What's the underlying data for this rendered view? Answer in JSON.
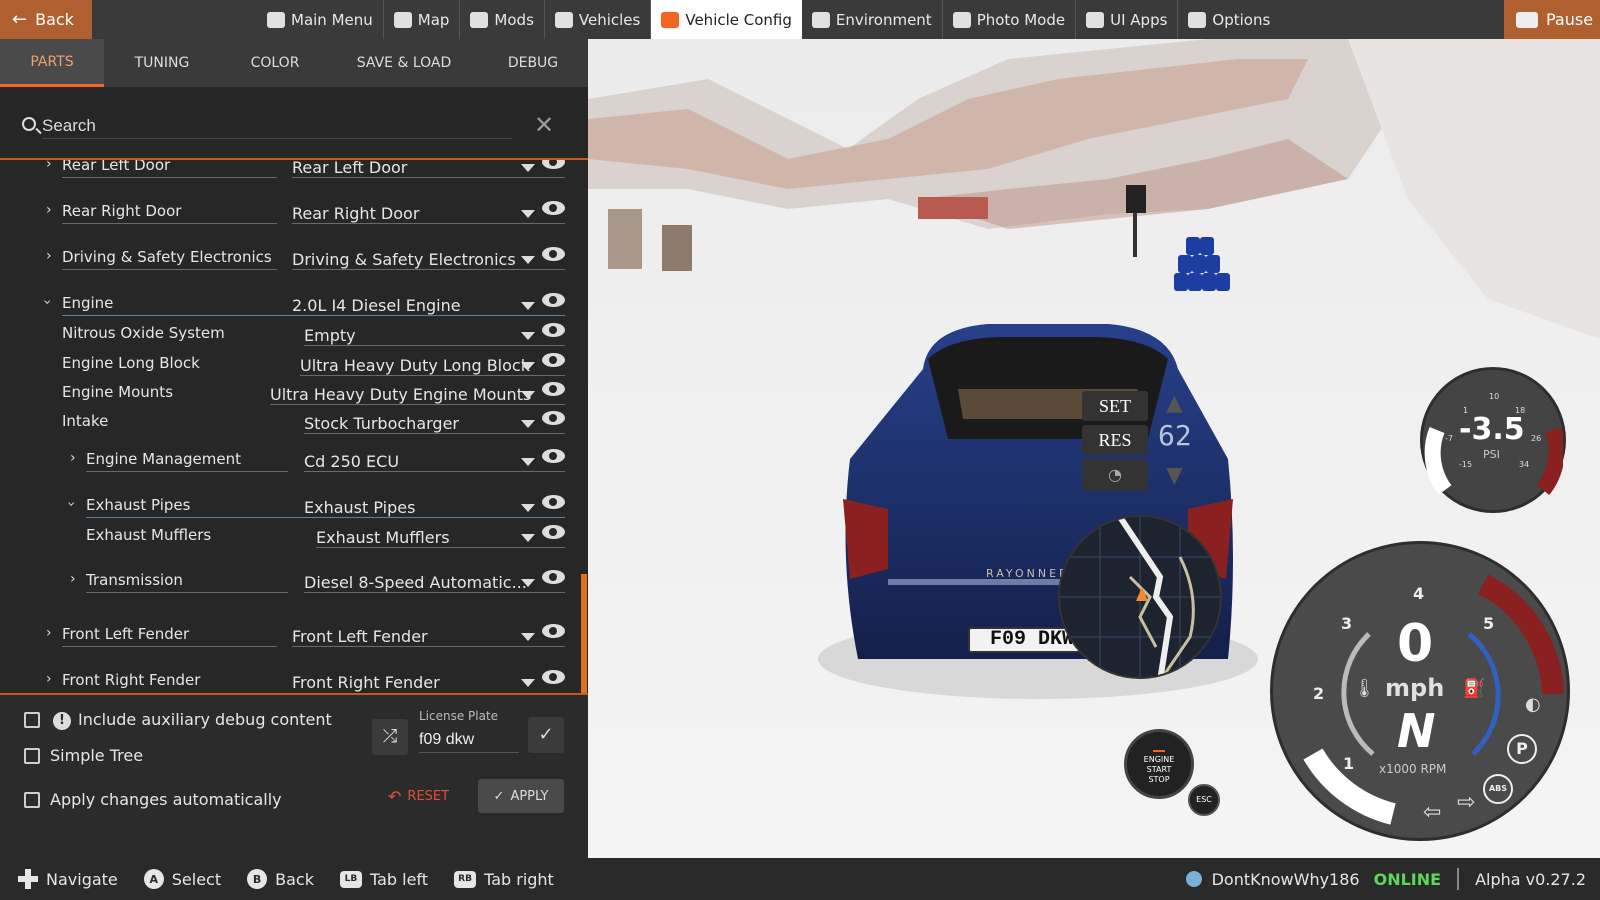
{
  "topbar": {
    "back": "Back",
    "pause": "Pause",
    "nav": [
      {
        "label": "Main Menu",
        "icon": "main-menu-icon",
        "active": false
      },
      {
        "label": "Map",
        "icon": "map-icon",
        "active": false
      },
      {
        "label": "Mods",
        "icon": "puzzle-icon",
        "active": false
      },
      {
        "label": "Vehicles",
        "icon": "car-icon",
        "active": false
      },
      {
        "label": "Vehicle Config",
        "icon": "engine-icon",
        "active": true
      },
      {
        "label": "Environment",
        "icon": "weather-icon",
        "active": false
      },
      {
        "label": "Photo Mode",
        "icon": "camera-icon",
        "active": false
      },
      {
        "label": "UI Apps",
        "icon": "apps-icon",
        "active": false
      },
      {
        "label": "Options",
        "icon": "sliders-icon",
        "active": false
      }
    ]
  },
  "tabs": [
    "PARTS",
    "TUNING",
    "COLOR",
    "SAVE & LOAD",
    "DEBUG"
  ],
  "search": {
    "placeholder": "Search"
  },
  "parts": [
    {
      "label": "Rear Left Door",
      "value": "Rear Left Door",
      "expandable": true,
      "expanded": false
    },
    {
      "label": "Rear Right Door",
      "value": "Rear Right Door",
      "expandable": true,
      "expanded": false
    },
    {
      "label": "Driving & Safety Electronics",
      "value": "Driving & Safety Electronics",
      "expandable": true,
      "expanded": false
    },
    {
      "label": "Engine",
      "value": "2.0L I4 Diesel Engine",
      "expandable": true,
      "expanded": true
    },
    {
      "label": "Nitrous Oxide System",
      "value": "Empty",
      "expandable": false
    },
    {
      "label": "Engine Long Block",
      "value": "Ultra Heavy Duty Long Block",
      "expandable": false
    },
    {
      "label": "Engine Mounts",
      "value": "Ultra Heavy Duty Engine Mounts",
      "expandable": false
    },
    {
      "label": "Intake",
      "value": "Stock Turbocharger",
      "expandable": false
    },
    {
      "label": "Engine Management",
      "value": "Cd 250 ECU",
      "expandable": true,
      "expanded": false
    },
    {
      "label": "Exhaust Pipes",
      "value": "Exhaust Pipes",
      "expandable": true,
      "expanded": true
    },
    {
      "label": "Exhaust Mufflers",
      "value": "Exhaust Mufflers",
      "expandable": false
    },
    {
      "label": "Transmission",
      "value": "Diesel 8-Speed Automatic...",
      "expandable": true,
      "expanded": false
    },
    {
      "label": "Front Left Fender",
      "value": "Front Left Fender",
      "expandable": true,
      "expanded": false
    },
    {
      "label": "Front Right Fender",
      "value": "Front Right Fender",
      "expandable": true,
      "expanded": false
    }
  ],
  "options": {
    "debug": "Include auxiliary debug content",
    "simple_tree": "Simple Tree",
    "auto_apply": "Apply changes automatically"
  },
  "license": {
    "label": "License Plate",
    "value": "f09 dkw"
  },
  "actions": {
    "reset": "RESET",
    "apply": "APPLY"
  },
  "hud": {
    "cruise": {
      "set": "SET",
      "res": "RES",
      "speed": "62"
    },
    "boost": {
      "value": "-3.5",
      "unit": "PSI",
      "ticks": [
        "-15",
        "-7",
        "1",
        "10",
        "18",
        "26",
        "34"
      ]
    },
    "speedo": {
      "speed": "0",
      "unit": "mph",
      "gear": "N",
      "rpm_label": "x1000 RPM",
      "rpm_ticks": [
        "1",
        "2",
        "3",
        "4",
        "5"
      ]
    },
    "plate": "F09 DKW",
    "engine_btn": [
      "ENGINE",
      "START",
      "STOP"
    ],
    "esc": "ESC",
    "abs": "ABS",
    "park": "P",
    "car_badge": "RAYONNER"
  },
  "status": {
    "hints": [
      {
        "key": "dpad",
        "label": "Navigate"
      },
      {
        "key": "A",
        "label": "Select"
      },
      {
        "key": "B",
        "label": "Back"
      },
      {
        "key": "LB",
        "label": "Tab left"
      },
      {
        "key": "RB",
        "label": "Tab right"
      }
    ],
    "user": "DontKnowWhy186",
    "online": "ONLINE",
    "version": "Alpha v0.27.2"
  }
}
